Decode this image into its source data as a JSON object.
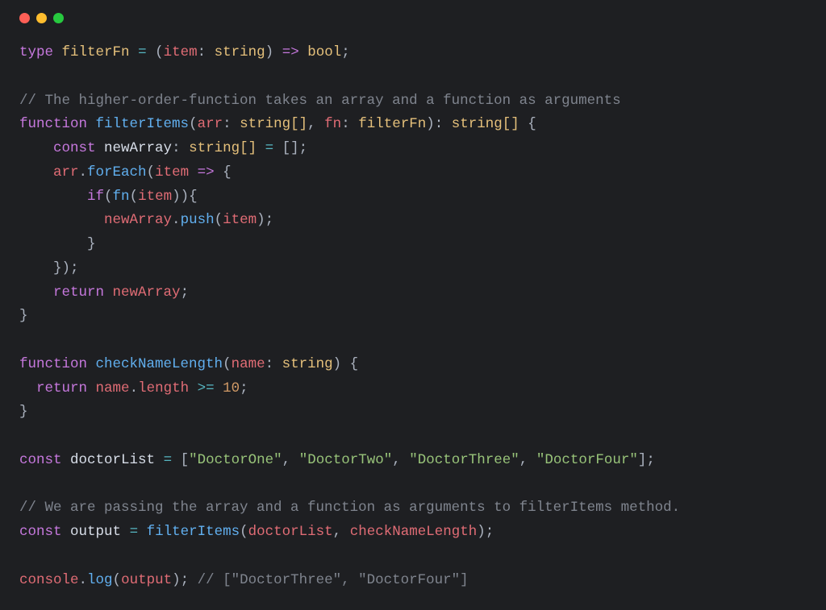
{
  "windowControls": [
    "red",
    "yellow",
    "green"
  ],
  "tokens": {
    "type": "type",
    "filterFn": "filterFn",
    "item": "item",
    "string": "string",
    "bool": "bool",
    "comment1": "// The higher-order-function takes an array and a function as arguments",
    "function": "function",
    "filterItems": "filterItems",
    "arr": "arr",
    "stringArr": "string[]",
    "fn": "fn",
    "const": "const",
    "newArray": "newArray",
    "forEach": "forEach",
    "if": "if",
    "push": "push",
    "return": "return",
    "checkNameLength": "checkNameLength",
    "name": "name",
    "length": "length",
    "gte": ">=",
    "ten": "10",
    "doctorList": "doctorList",
    "d1": "\"DoctorOne\"",
    "d2": "\"DoctorTwo\"",
    "d3": "\"DoctorThree\"",
    "d4": "\"DoctorFour\"",
    "comment2": "// We are passing the array and a function as arguments to filterItems method.",
    "output": "output",
    "console": "console",
    "log": "log",
    "comment3": "// [\"DoctorThree\", \"DoctorFour\"]"
  }
}
